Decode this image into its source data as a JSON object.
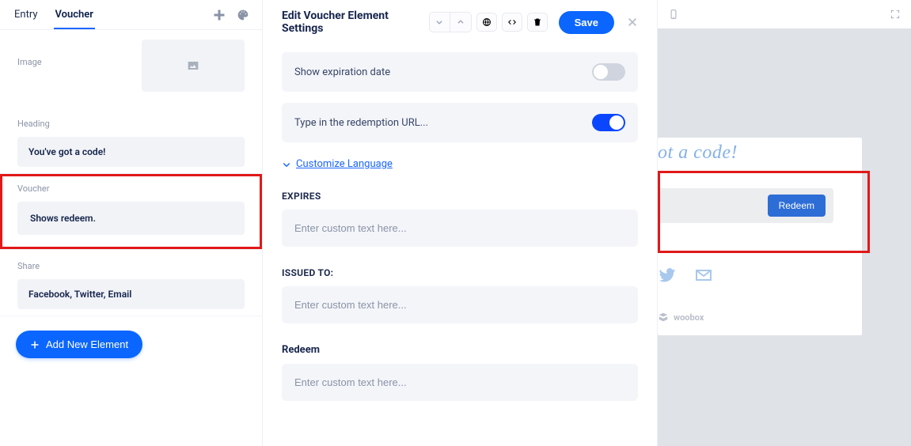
{
  "tabs": {
    "entry": "Entry",
    "voucher": "Voucher",
    "active": "voucher"
  },
  "sections": {
    "image_label": "Image",
    "heading": {
      "label": "Heading",
      "value": "You've got a code!"
    },
    "voucher": {
      "label": "Voucher",
      "value": "Shows redeem."
    },
    "share": {
      "label": "Share",
      "value": "Facebook, Twitter, Email"
    }
  },
  "add_button": "Add New Element",
  "editor": {
    "title": "Edit Voucher Element Settings",
    "save": "Save",
    "rows": {
      "expiration": {
        "label": "Show expiration date",
        "on": false
      },
      "redemption": {
        "label": "Type in the redemption URL...",
        "on": true
      }
    },
    "customize": "Customize Language",
    "fields": {
      "expires": {
        "label": "EXPIRES",
        "placeholder": "Enter custom text here..."
      },
      "issued": {
        "label": "ISSUED TO:",
        "placeholder": "Enter custom text here..."
      },
      "redeem": {
        "label": "Redeem",
        "placeholder": "Enter custom text here..."
      }
    }
  },
  "preview": {
    "heading_fragment": "ot a code!",
    "redeem_button": "Redeem",
    "brand": "woobox"
  }
}
